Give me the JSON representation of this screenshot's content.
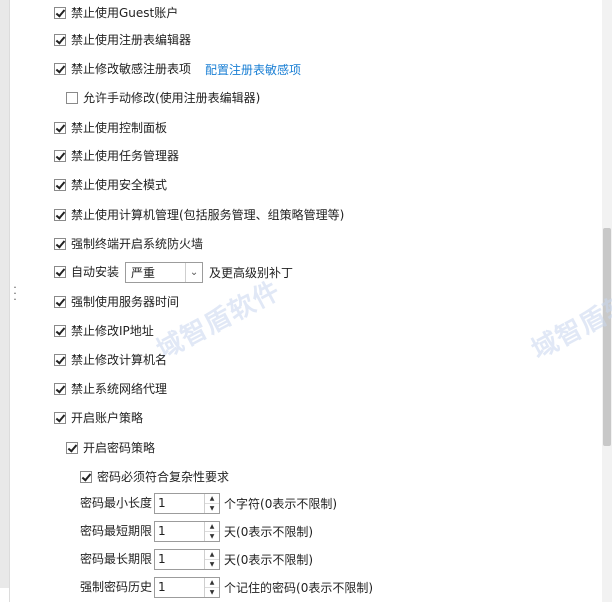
{
  "options": {
    "disable_guest": {
      "label": "禁止使用Guest账户",
      "checked": true
    },
    "disable_regedit": {
      "label": "禁止使用注册表编辑器",
      "checked": true
    },
    "disable_sensitive_reg": {
      "label": "禁止修改敏感注册表项",
      "checked": true,
      "link": "配置注册表敏感项"
    },
    "allow_manual": {
      "label": "允许手动修改(使用注册表编辑器)",
      "checked": false
    },
    "disable_control_panel": {
      "label": "禁止使用控制面板",
      "checked": true
    },
    "disable_task_manager": {
      "label": "禁止使用任务管理器",
      "checked": true
    },
    "disable_safe_mode": {
      "label": "禁止使用安全模式",
      "checked": true
    },
    "disable_computer_mgmt": {
      "label": "禁止使用计算机管理(包括服务管理、组策略管理等)",
      "checked": true
    },
    "force_firewall": {
      "label": "强制终端开启系统防火墙",
      "checked": true
    },
    "auto_install": {
      "label": "自动安装",
      "checked": true,
      "select_value": "严重",
      "after": "及更高级别补丁"
    },
    "force_server_time": {
      "label": "强制使用服务器时间",
      "checked": true
    },
    "disable_ip_change": {
      "label": "禁止修改IP地址",
      "checked": true
    },
    "disable_rename": {
      "label": "禁止修改计算机名",
      "checked": true
    },
    "disable_proxy": {
      "label": "禁止系统网络代理",
      "checked": true
    },
    "account_policy": {
      "label": "开启账户策略",
      "checked": true
    },
    "password_policy": {
      "label": "开启密码策略",
      "checked": true
    },
    "complexity": {
      "label": "密码必须符合复杂性要求",
      "checked": true
    }
  },
  "fields": {
    "min_length": {
      "label": "密码最小长度",
      "value": "1",
      "suffix": "个字符(0表示不限制)"
    },
    "min_age": {
      "label": "密码最短期限",
      "value": "1",
      "suffix": "天(0表示不限制)"
    },
    "max_age": {
      "label": "密码最长期限",
      "value": "1",
      "suffix": "天(0表示不限制)"
    },
    "history": {
      "label": "强制密码历史",
      "value": "1",
      "suffix": "个记住的密码(0表示不限制)"
    }
  },
  "watermark": "域智盾软件"
}
